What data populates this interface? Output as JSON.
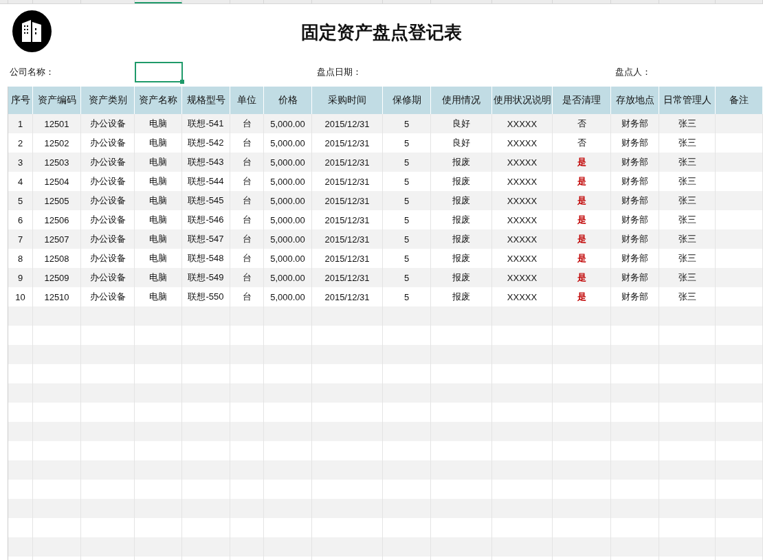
{
  "title": "固定资产盘点登记表",
  "info": [
    {
      "label": "公司名称："
    },
    {
      "label": "盘点日期："
    },
    {
      "label": "盘点人："
    }
  ],
  "table": {
    "columns": [
      "序号",
      "资产编码",
      "资产类别",
      "资产名称",
      "规格型号",
      "单位",
      "价格",
      "采购时间",
      "保修期",
      "使用情况",
      "使用状况说明",
      "是否清理",
      "存放地点",
      "日常管理人",
      "备注"
    ],
    "rows": [
      {
        "cells": [
          "1",
          "12501",
          "办公设备",
          "电脑",
          "联想-541",
          "台",
          "5,000.00",
          "2015/12/31",
          "5",
          "良好",
          "XXXXX",
          "否",
          "财务部",
          "张三"
        ],
        "flagged": false
      },
      {
        "cells": [
          "2",
          "12502",
          "办公设备",
          "电脑",
          "联想-542",
          "台",
          "5,000.00",
          "2015/12/31",
          "5",
          "良好",
          "XXXXX",
          "否",
          "财务部",
          "张三"
        ],
        "flagged": false
      },
      {
        "cells": [
          "3",
          "12503",
          "办公设备",
          "电脑",
          "联想-543",
          "台",
          "5,000.00",
          "2015/12/31",
          "5",
          "报废",
          "XXXXX",
          "是",
          "财务部",
          "张三"
        ],
        "flagged": true
      },
      {
        "cells": [
          "4",
          "12504",
          "办公设备",
          "电脑",
          "联想-544",
          "台",
          "5,000.00",
          "2015/12/31",
          "5",
          "报废",
          "XXXXX",
          "是",
          "财务部",
          "张三"
        ],
        "flagged": true
      },
      {
        "cells": [
          "5",
          "12505",
          "办公设备",
          "电脑",
          "联想-545",
          "台",
          "5,000.00",
          "2015/12/31",
          "5",
          "报废",
          "XXXXX",
          "是",
          "财务部",
          "张三"
        ],
        "flagged": true
      },
      {
        "cells": [
          "6",
          "12506",
          "办公设备",
          "电脑",
          "联想-546",
          "台",
          "5,000.00",
          "2015/12/31",
          "5",
          "报废",
          "XXXXX",
          "是",
          "财务部",
          "张三"
        ],
        "flagged": true
      },
      {
        "cells": [
          "7",
          "12507",
          "办公设备",
          "电脑",
          "联想-547",
          "台",
          "5,000.00",
          "2015/12/31",
          "5",
          "报废",
          "XXXXX",
          "是",
          "财务部",
          "张三"
        ],
        "flagged": true
      },
      {
        "cells": [
          "8",
          "12508",
          "办公设备",
          "电脑",
          "联想-548",
          "台",
          "5,000.00",
          "2015/12/31",
          "5",
          "报废",
          "XXXXX",
          "是",
          "财务部",
          "张三"
        ],
        "flagged": true
      },
      {
        "cells": [
          "9",
          "12509",
          "办公设备",
          "电脑",
          "联想-549",
          "台",
          "5,000.00",
          "2015/12/31",
          "5",
          "报废",
          "XXXXX",
          "是",
          "财务部",
          "张三"
        ],
        "flagged": true
      },
      {
        "cells": [
          "10",
          "12510",
          "办公设备",
          "电脑",
          "联想-550",
          "台",
          "5,000.00",
          "2015/12/31",
          "5",
          "报废",
          "XXXXX",
          "是",
          "财务部",
          "张三"
        ],
        "flagged": true
      }
    ]
  }
}
